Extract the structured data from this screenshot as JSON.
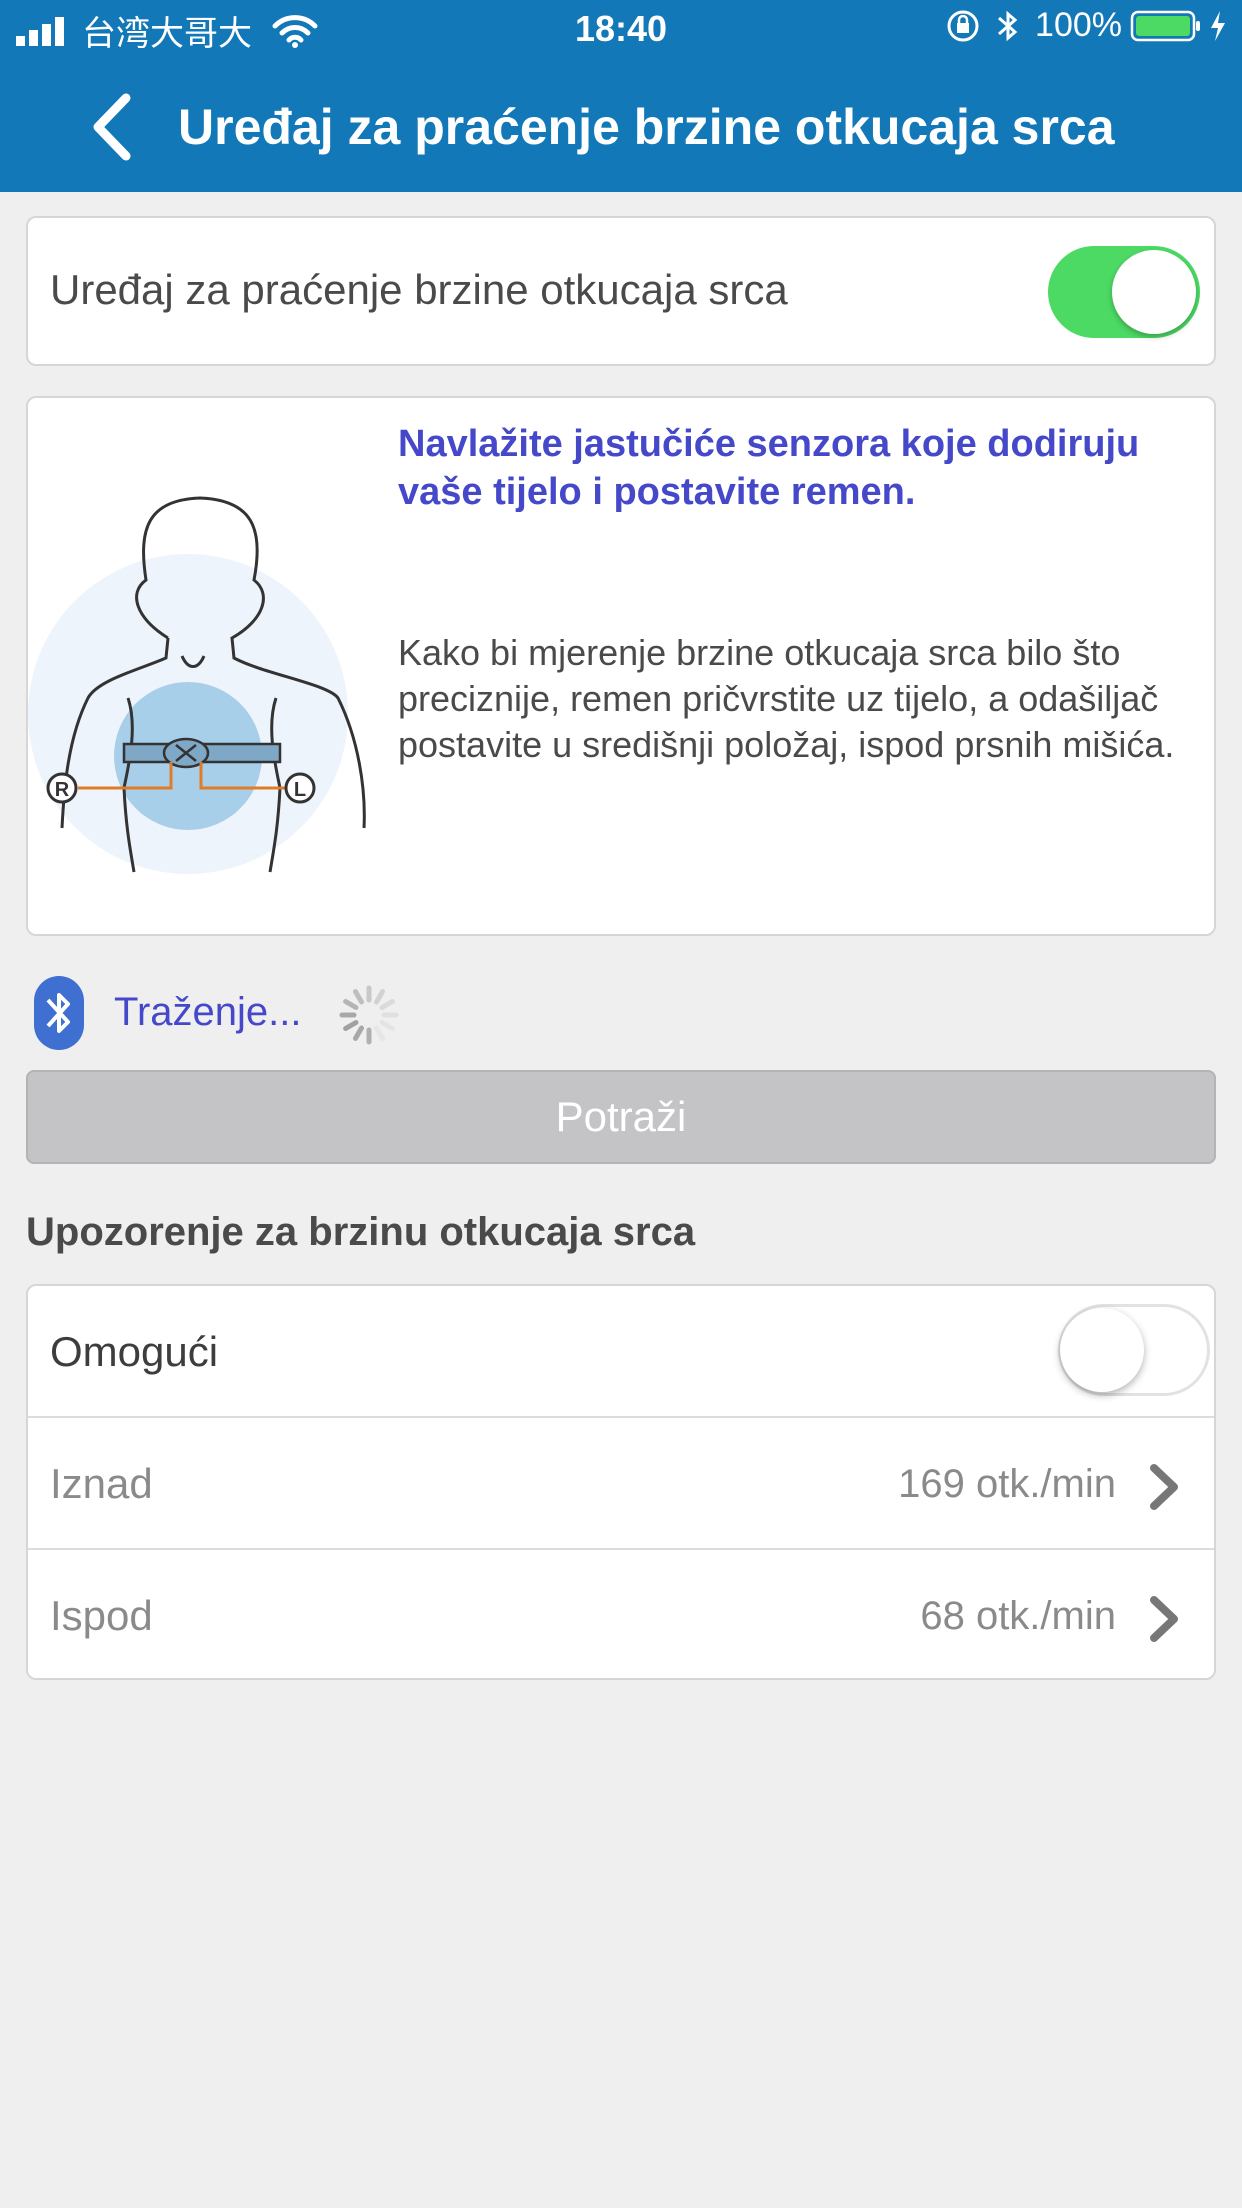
{
  "status_bar": {
    "carrier": "台湾大哥大",
    "time": "18:40",
    "battery": "100%"
  },
  "nav": {
    "title": "Uređaj za praćenje brzine otkucaja srca"
  },
  "device_toggle": {
    "label": "Uređaj za praćenje brzine otkucaja srca",
    "enabled": true
  },
  "info": {
    "heading": "Navlažite jastučiće senzora koje dodiruju vaše tijelo i postavite remen.",
    "body": "Kako bi mjerenje brzine otkucaja srca bilo što preciznije, remen pričvrstite uz tijelo, a odašiljač postavite u središnji položaj, ispod prsnih mišića.",
    "diagram_labels": {
      "right": "R",
      "left": "L"
    }
  },
  "search": {
    "status": "Traženje...",
    "button": "Potraži"
  },
  "alert": {
    "section_title": "Upozorenje za brzinu otkucaja srca",
    "enable_label": "Omogući",
    "enabled": false,
    "rows": [
      {
        "label": "Iznad",
        "value": "169 otk./min"
      },
      {
        "label": "Ispod",
        "value": "68 otk./min"
      }
    ]
  },
  "colors": {
    "nav_blue": "#1278b8",
    "accent_blue": "#4548c8",
    "switch_green": "#4cd964"
  }
}
